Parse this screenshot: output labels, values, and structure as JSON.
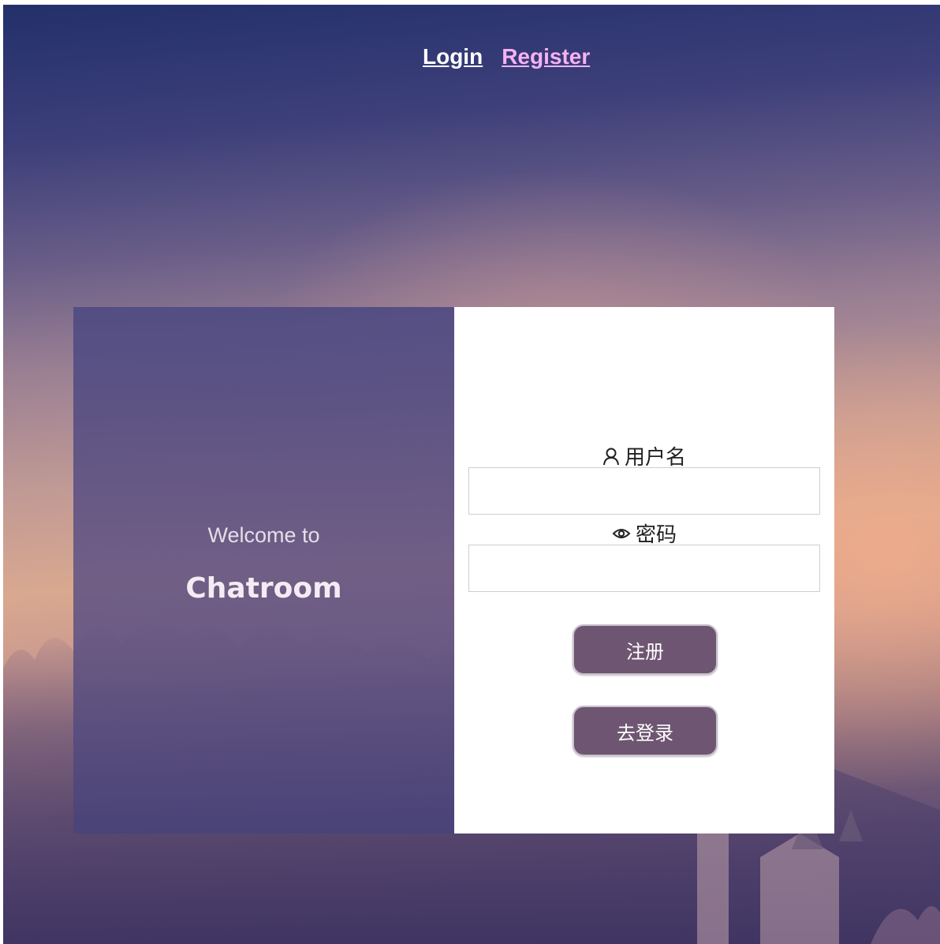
{
  "nav": {
    "login_label": "Login",
    "register_label": "Register"
  },
  "left_panel": {
    "welcome_text": "Welcome to",
    "brand_text": "Chatroom"
  },
  "form": {
    "username_label": "用户名",
    "username_icon": "user-icon",
    "username_value": "",
    "password_label": "密码",
    "password_icon": "eye-icon",
    "password_value": "",
    "register_button": "注册",
    "goto_login_button": "去登录"
  },
  "colors": {
    "button_bg": "#6e5571",
    "register_link": "#f6b2f2",
    "login_link": "#ffffff"
  }
}
